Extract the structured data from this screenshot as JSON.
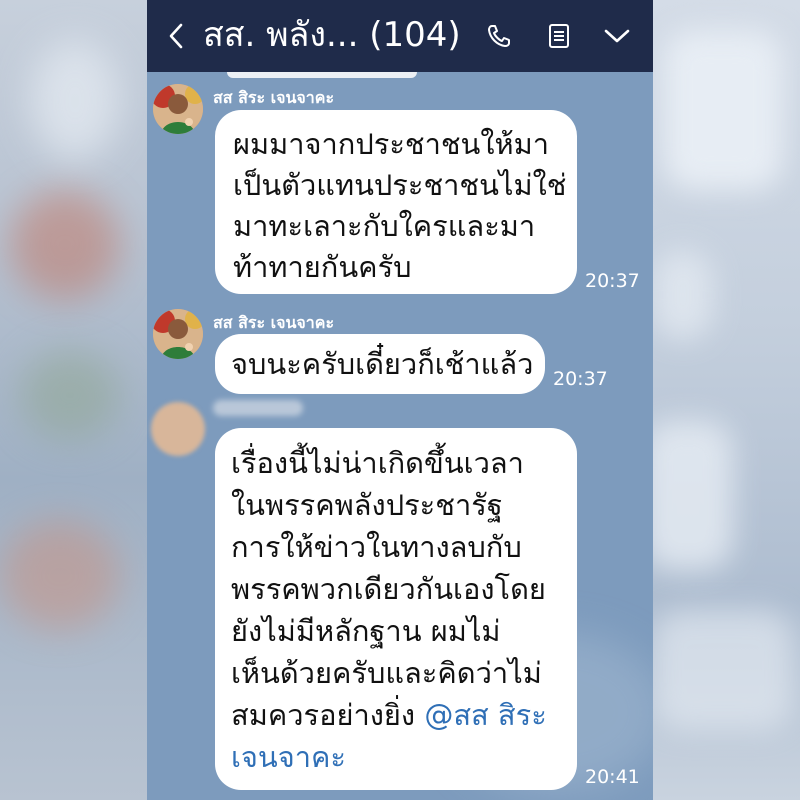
{
  "header": {
    "title": "สส. พลัง... (104)",
    "icons": [
      "chevron-left-icon",
      "phone-icon",
      "notes-icon",
      "chevron-down-icon"
    ]
  },
  "messages": [
    {
      "sender": "สส สิระ เจนจาคะ",
      "lines": [
        "ผมมาจากประชาชนให้มา",
        "เป็นตัวแทนประชาชนไม่ใช่",
        "มาทะเลาะกับใครและมา",
        "ท้าทายกันครับ"
      ],
      "time": "20:37"
    },
    {
      "sender": "สส สิระ เจนจาคะ",
      "lines": [
        "จบนะครับเดี๋ยวก็เช้าแล้ว"
      ],
      "time": "20:37"
    },
    {
      "sender": "",
      "lines": [
        "เรื่องนี้ไม่น่าเกิดขึ้นเวลา",
        "ในพรรคพลังประชารัฐ",
        "การให้ข่าวในทางลบกับ",
        "พรรคพวกเดียวกันเองโดย",
        "ยังไม่มีหลักฐาน ผมไม่",
        "เห็นด้วยครับและคิดว่าไม่"
      ],
      "last_line_text": "สมควรอย่างยิ่ง ",
      "mention": "@สส สิระ",
      "mention_cont": "เจนจาคะ",
      "time": "20:41"
    }
  ],
  "colors": {
    "header_bg": "#1f2b4a",
    "chat_bg": "#7d9bbd",
    "bubble": "#ffffff",
    "mention": "#2f6fb6"
  }
}
